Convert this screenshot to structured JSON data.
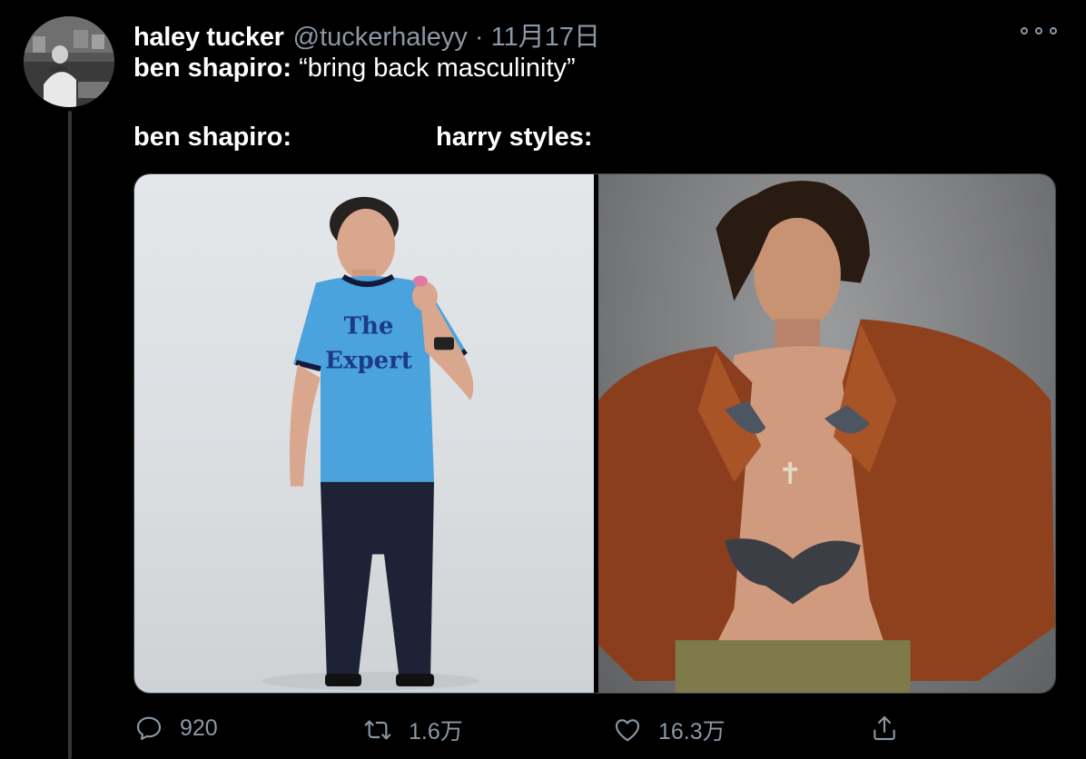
{
  "tweet": {
    "author": {
      "display_name": "haley tucker",
      "handle": "@tuckerhaleyy",
      "separator": "·",
      "timestamp": "11月17日"
    },
    "text": {
      "line1_name": "ben shapiro:",
      "line1_quote": " “bring back masculinity”",
      "caption_left": "ben shapiro:",
      "caption_right": "harry styles:"
    },
    "media": {
      "left_photo_shirt_text_1": "The",
      "left_photo_shirt_text_2": "Expert"
    },
    "actions": {
      "reply_count": "920",
      "retweet_count": "1.6万",
      "like_count": "16.3万"
    },
    "icons": {
      "more": "more-horizontal-icon",
      "reply": "reply-icon",
      "retweet": "retweet-icon",
      "like": "heart-icon",
      "share": "share-icon"
    },
    "colors": {
      "background": "#000000",
      "text_primary": "#ffffff",
      "text_secondary": "#8b98a5",
      "border": "#38444d"
    }
  }
}
